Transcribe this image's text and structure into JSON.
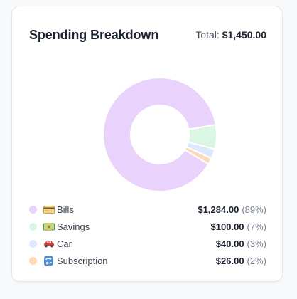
{
  "header": {
    "title": "Spending Breakdown",
    "total_label": "Total:",
    "total_value": "$1,450.00"
  },
  "chart_data": {
    "type": "pie",
    "categories": [
      "Bills",
      "Savings",
      "Car",
      "Subscription"
    ],
    "values": [
      1284.0,
      100.0,
      40.0,
      26.0
    ],
    "colors": [
      "#e9d2fb",
      "#d9f7e3",
      "#dde7fd",
      "#fdd9b7"
    ]
  },
  "legend": [
    {
      "icon": "credit-card-icon",
      "label": "Bills",
      "amount": "$1,284.00",
      "percent": "(89%)",
      "color": "#e9d2fb"
    },
    {
      "icon": "money-icon",
      "label": "Savings",
      "amount": "$100.00",
      "percent": "(7%)",
      "color": "#d9f7e3"
    },
    {
      "icon": "car-icon",
      "label": "Car",
      "amount": "$40.00",
      "percent": "(3%)",
      "color": "#dde7fd"
    },
    {
      "icon": "repeat-icon",
      "label": "Subscription",
      "amount": "$26.00",
      "percent": "(2%)",
      "color": "#fdd9b7"
    }
  ]
}
